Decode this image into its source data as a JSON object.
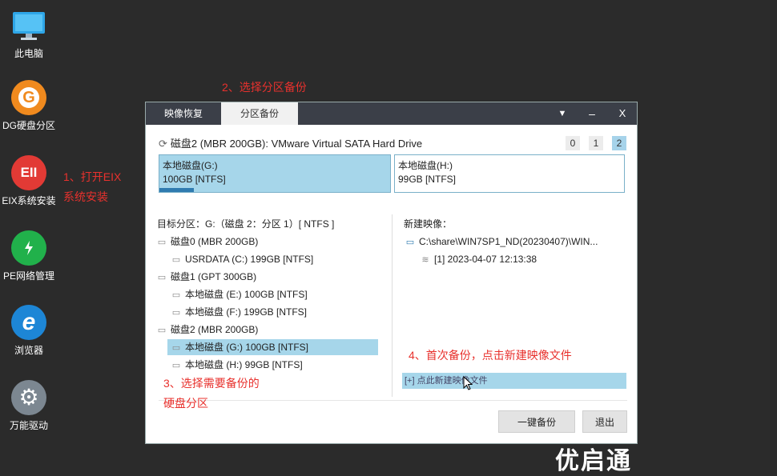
{
  "desktop": {
    "icons": [
      {
        "label": "此电脑"
      },
      {
        "label": "DG硬盘分区",
        "glyph": "G"
      },
      {
        "label": "EIX系统安装",
        "glyph": "EII"
      },
      {
        "label": "PE网络管理",
        "glyph": "⚟"
      },
      {
        "label": "浏览器",
        "glyph": "e"
      },
      {
        "label": "万能驱动",
        "glyph": "⚙"
      }
    ]
  },
  "annotations": {
    "step1_line1": "1、打开EIX",
    "step1_line2": "系统安装",
    "step2": "2、选择分区备份",
    "step3_line1": "3、选择需要备份的",
    "step3_line2": "硬盘分区",
    "step4": "4、首次备份，点击新建映像文件"
  },
  "window": {
    "tabs": [
      "映像恢复",
      "分区备份"
    ],
    "controls": {
      "menu": "▼",
      "minimize": "–",
      "close": "X"
    },
    "disk_header": "磁盘2 (MBR 200GB): VMware Virtual SATA Hard Drive",
    "disk_pages": [
      "0",
      "1",
      "2"
    ],
    "partitions": [
      {
        "line1": "本地磁盘(G:)",
        "line2": "100GB [NTFS]"
      },
      {
        "line1": "本地磁盘(H:)",
        "line2": "99GB [NTFS]"
      }
    ],
    "target_label": "目标分区：",
    "target_value": "G:（磁盘 2：分区 1）[ NTFS ]",
    "tree": [
      "磁盘0 (MBR 200GB)",
      "USRDATA (C:) 199GB [NTFS]",
      "磁盘1 (GPT 300GB)",
      "本地磁盘 (E:) 100GB [NTFS]",
      "本地磁盘 (F:) 199GB [NTFS]",
      "磁盘2 (MBR 200GB)",
      "本地磁盘 (G:) 100GB [NTFS]",
      "本地磁盘 (H:) 99GB [NTFS]"
    ],
    "new_image_label": "新建映像：",
    "image_path": "C:\\share\\WIN7SP1_ND(20230407)\\WIN...",
    "image_entry": "[1] 2023-04-07 12:13:38",
    "new_image_link": "[+] 点此新建映像文件",
    "btn_backup": "一键备份",
    "btn_exit": "退出"
  },
  "watermark": "优启通",
  "colors": {
    "desktop_bg": "#2b2b2b",
    "titlebar": "#3b3f48",
    "selection": "#a6d6ea",
    "annotation": "#e8312d"
  }
}
